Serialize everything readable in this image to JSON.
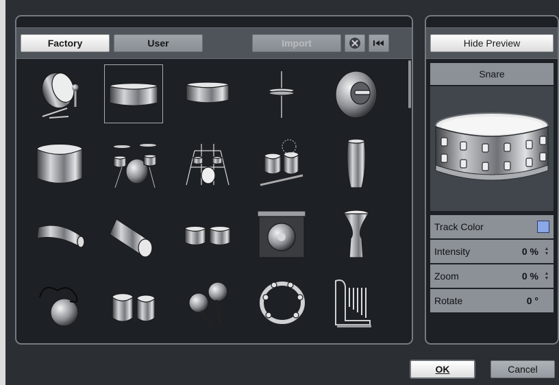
{
  "browser": {
    "tabs": {
      "factory": "Factory",
      "user": "User"
    },
    "import_label": "Import",
    "clear_icon": "x-circle-icon",
    "rewind_icon": "skip-back-icon",
    "selected_index": 1,
    "icons": [
      "bass-drum-with-pedal",
      "snare-drum-wide",
      "snare-drum",
      "hi-hat",
      "cymbal",
      "floor-tom",
      "drum-kit",
      "drum-kit-large",
      "world-percussion-kit",
      "conga",
      "dholak",
      "dhol",
      "bongos",
      "gong",
      "djembe",
      "shaker-gourd",
      "tabla",
      "maracas",
      "tambourine",
      "chimes"
    ]
  },
  "preview": {
    "hide_preview_label": "Hide Preview",
    "instrument_name": "Snare",
    "track_color_label": "Track Color",
    "track_color": "#8aa7e6",
    "intensity_label": "Intensity",
    "intensity_value": "0 %",
    "zoom_label": "Zoom",
    "zoom_value": "0 %",
    "rotate_label": "Rotate",
    "rotate_value": "0 °"
  },
  "footer": {
    "ok_label": "OK",
    "cancel_label": "Cancel"
  }
}
